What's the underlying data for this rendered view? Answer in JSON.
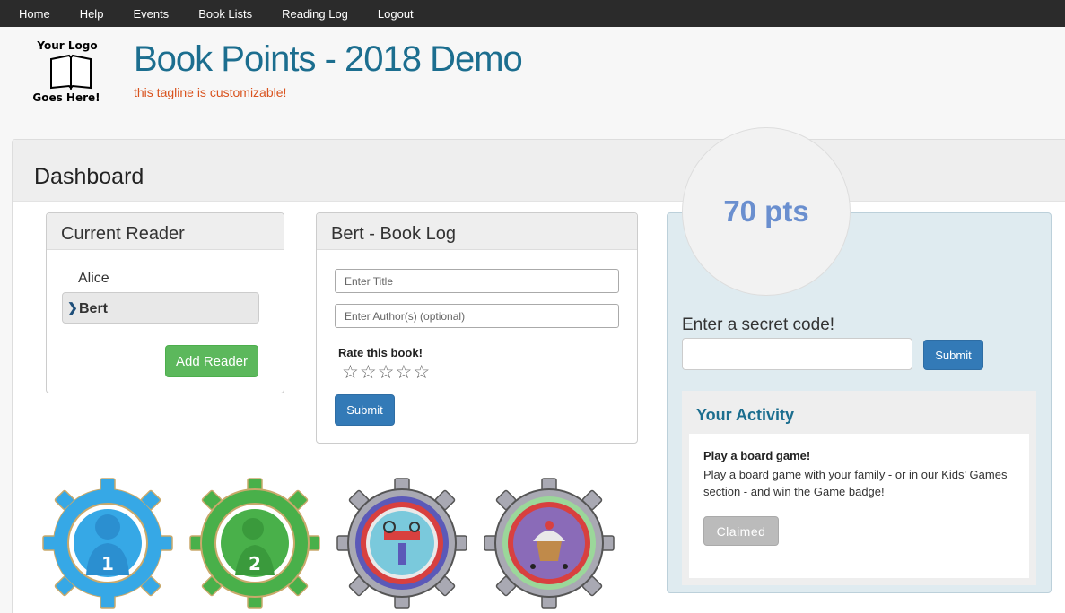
{
  "nav": {
    "items": [
      "Home",
      "Help",
      "Events",
      "Book Lists",
      "Reading Log",
      "Logout"
    ]
  },
  "logo": {
    "line1": "Your  Logo",
    "line2": "Goes Here!"
  },
  "header": {
    "title": "Book Points - 2018 Demo",
    "tagline": "this tagline is customizable!"
  },
  "dashboard": {
    "title": "Dashboard"
  },
  "reader_panel": {
    "title": "Current Reader",
    "readers": [
      "Alice",
      "Bert"
    ],
    "active_reader": "Bert",
    "add_label": "Add Reader"
  },
  "book_log": {
    "title": "Bert - Book Log",
    "title_placeholder": "Enter Title",
    "author_placeholder": "Enter Author(s) (optional)",
    "rate_label": "Rate this book!",
    "star_count": 5,
    "submit_label": "Submit"
  },
  "points": {
    "value": "70 pts"
  },
  "secret": {
    "label": "Enter a secret code!",
    "value": "",
    "submit_label": "Submit"
  },
  "activity": {
    "title": "Your Activity",
    "name": "Play a board game!",
    "description": "Play a board game with your family - or in our Kids' Games section - and win the Game badge!",
    "button_label": "Claimed"
  },
  "badges": [
    {
      "name": "badge-reader-1",
      "number": "1",
      "color": "#36a8e6",
      "inner": "#4aaee8"
    },
    {
      "name": "badge-reader-2",
      "number": "2",
      "color": "#49b04a",
      "inner": "#3fa341"
    },
    {
      "name": "badge-reading",
      "color": "#9a9aa6",
      "inner": "#7ac9dc"
    },
    {
      "name": "badge-cupcake",
      "color": "#9a9aa6",
      "inner": "#8a6bb8"
    }
  ],
  "colors": {
    "nav_bg": "#2b2b2b",
    "title": "#1c6e8f",
    "tagline": "#d9531e",
    "green": "#5cb85c",
    "blue": "#337ab7",
    "points": "#6a8fcf"
  }
}
